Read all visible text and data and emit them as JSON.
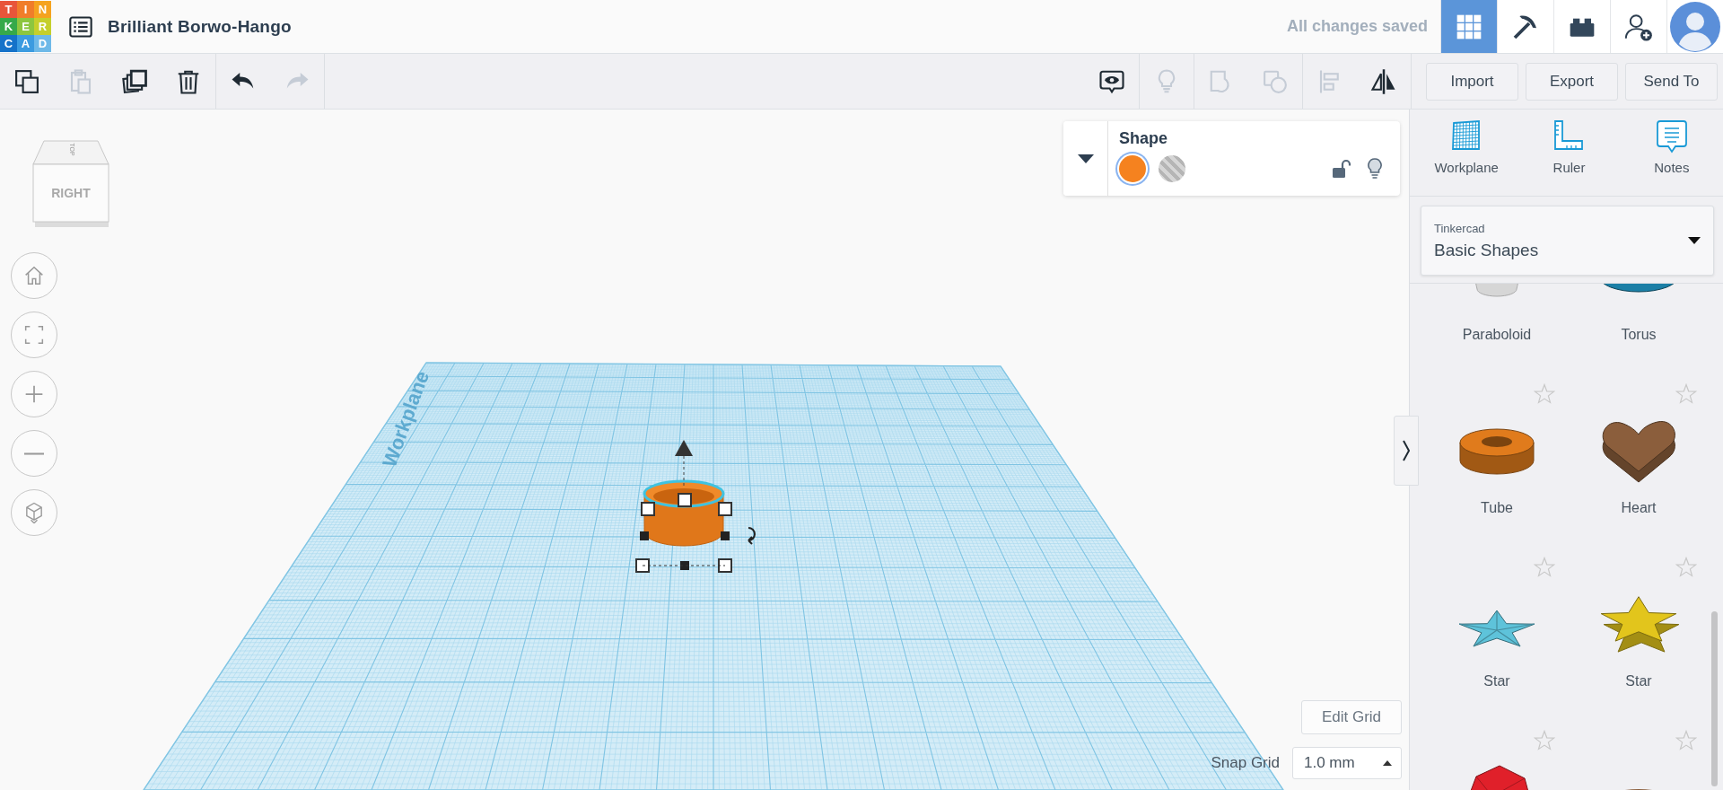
{
  "header": {
    "logo": [
      {
        "letter": "T",
        "color": "#e8553a"
      },
      {
        "letter": "I",
        "color": "#f07d2a"
      },
      {
        "letter": "N",
        "color": "#f5a31f"
      },
      {
        "letter": "K",
        "color": "#36a94a"
      },
      {
        "letter": "E",
        "color": "#8cc63f"
      },
      {
        "letter": "R",
        "color": "#c5cf2c"
      },
      {
        "letter": "C",
        "color": "#1572c9"
      },
      {
        "letter": "A",
        "color": "#3b9be0"
      },
      {
        "letter": "D",
        "color": "#6eb9e8"
      }
    ],
    "title": "Brilliant Borwo-Hango",
    "save_status": "All changes saved",
    "apps": [
      {
        "kind": "design",
        "selected": true
      },
      {
        "kind": "build",
        "selected": false
      },
      {
        "kind": "bricks",
        "selected": false
      }
    ]
  },
  "toolbar": {
    "edit_tools": [
      {
        "kind": "copy",
        "disabled": false
      },
      {
        "kind": "paste",
        "disabled": true
      },
      {
        "kind": "duplicate",
        "disabled": false
      },
      {
        "kind": "delete",
        "disabled": false
      }
    ],
    "history": [
      {
        "kind": "undo",
        "disabled": false
      },
      {
        "kind": "redo",
        "disabled": true
      }
    ],
    "view_tools": [
      [
        {
          "kind": "notes",
          "disabled": false
        }
      ],
      [
        {
          "kind": "show",
          "disabled": true
        }
      ],
      [
        {
          "kind": "group",
          "disabled": true
        },
        {
          "kind": "ungroup",
          "disabled": true
        }
      ],
      [
        {
          "kind": "align",
          "disabled": true
        },
        {
          "kind": "mirror",
          "disabled": false
        }
      ]
    ],
    "buttons": [
      "Import",
      "Export",
      "Send To"
    ]
  },
  "view_cube": {
    "face": "RIGHT",
    "top": "TOP"
  },
  "workplane_label": "Workplane",
  "shape_inspector": {
    "title": "Shape",
    "fill": [
      {
        "kind": "solid",
        "color": "#f5821f",
        "selected": true
      },
      {
        "kind": "hole",
        "selected": false
      }
    ],
    "locked": false
  },
  "grid_controls": {
    "edit_button": "Edit Grid",
    "snap_label": "Snap Grid",
    "snap_value": "1.0 mm"
  },
  "side_panel": {
    "tools": [
      {
        "kind": "workplane",
        "label": "Workplane"
      },
      {
        "kind": "ruler",
        "label": "Ruler"
      },
      {
        "kind": "notes",
        "label": "Notes"
      }
    ],
    "library": {
      "provider": "Tinkercad",
      "category": "Basic Shapes"
    },
    "shapes": [
      {
        "kind": "paraboloid",
        "label": "Paraboloid",
        "color": "#d6d6d6"
      },
      {
        "kind": "torus",
        "label": "Torus",
        "color": "#1b7fa6"
      },
      {
        "kind": "tube",
        "label": "Tube",
        "color": "#e07b1c",
        "favorite": false
      },
      {
        "kind": "heart",
        "label": "Heart",
        "color": "#8b5e3c",
        "favorite": false
      },
      {
        "kind": "starpyramid",
        "label": "Star",
        "color": "#5ec3da",
        "favorite": false
      },
      {
        "kind": "star",
        "label": "Star",
        "color": "#e2c51c",
        "favorite": false
      },
      {
        "kind": "gem",
        "color": "#e0202a",
        "favorite": false
      },
      {
        "kind": "ring",
        "color": "#8b5e3c",
        "favorite": false
      }
    ]
  }
}
